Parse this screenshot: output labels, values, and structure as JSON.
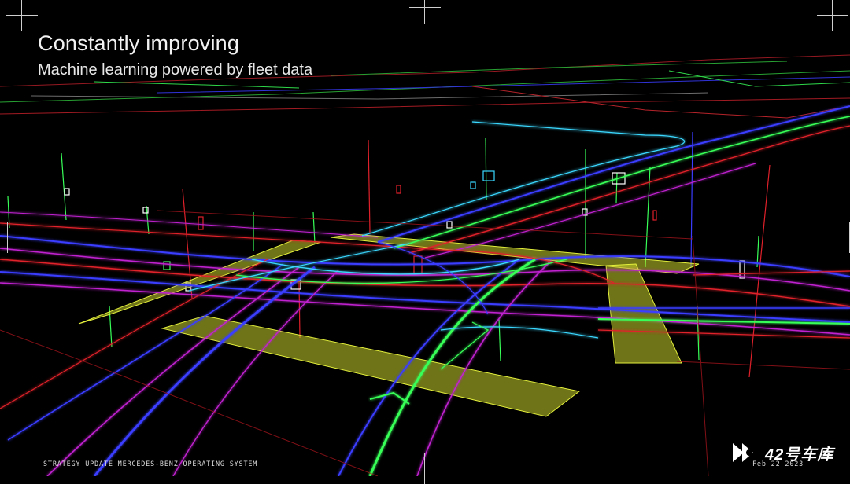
{
  "slide": {
    "title": "Constantly improving",
    "subtitle": "Machine learning powered by fleet data",
    "footer": "STRATEGY UPDATE  MERCEDES-BENZ OPERATING SYSTEM",
    "date": "Feb 22 2023"
  },
  "watermark": {
    "text": "42号车库",
    "icon": "play-arrows-logo-icon"
  },
  "colors": {
    "background": "#000000",
    "lane_blue": "#3a3cff",
    "lane_green": "#38ff58",
    "lane_red": "#e0202a",
    "crosswalk": "#d4e03a",
    "cyan": "#3ad8ff",
    "magenta": "#c020d0"
  }
}
